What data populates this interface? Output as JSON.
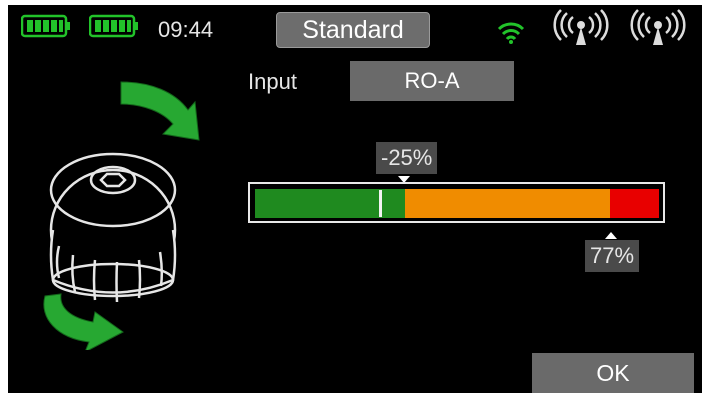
{
  "status_bar": {
    "battery_icons": [
      "battery-full-icon",
      "battery-full-icon"
    ],
    "time": "09:44",
    "mode": "Standard",
    "wifi_icon": "wifi-icon",
    "antenna_icons": [
      "antenna-icon",
      "antenna-icon"
    ]
  },
  "input": {
    "label": "Input",
    "value": "RO-A"
  },
  "trim_bar": {
    "trim_label": "-25%",
    "max_label": "77%",
    "trim_value_percent": -25,
    "max_value_percent": 77,
    "colors": {
      "green": "#1f8a1f",
      "orange": "#f08c00",
      "red": "#e80000"
    }
  },
  "knob_icon": "rotary-knob-icon",
  "arrow_icons": [
    "rotate-arrow-icon",
    "rotate-arrow-icon"
  ],
  "ok_label": "OK"
}
